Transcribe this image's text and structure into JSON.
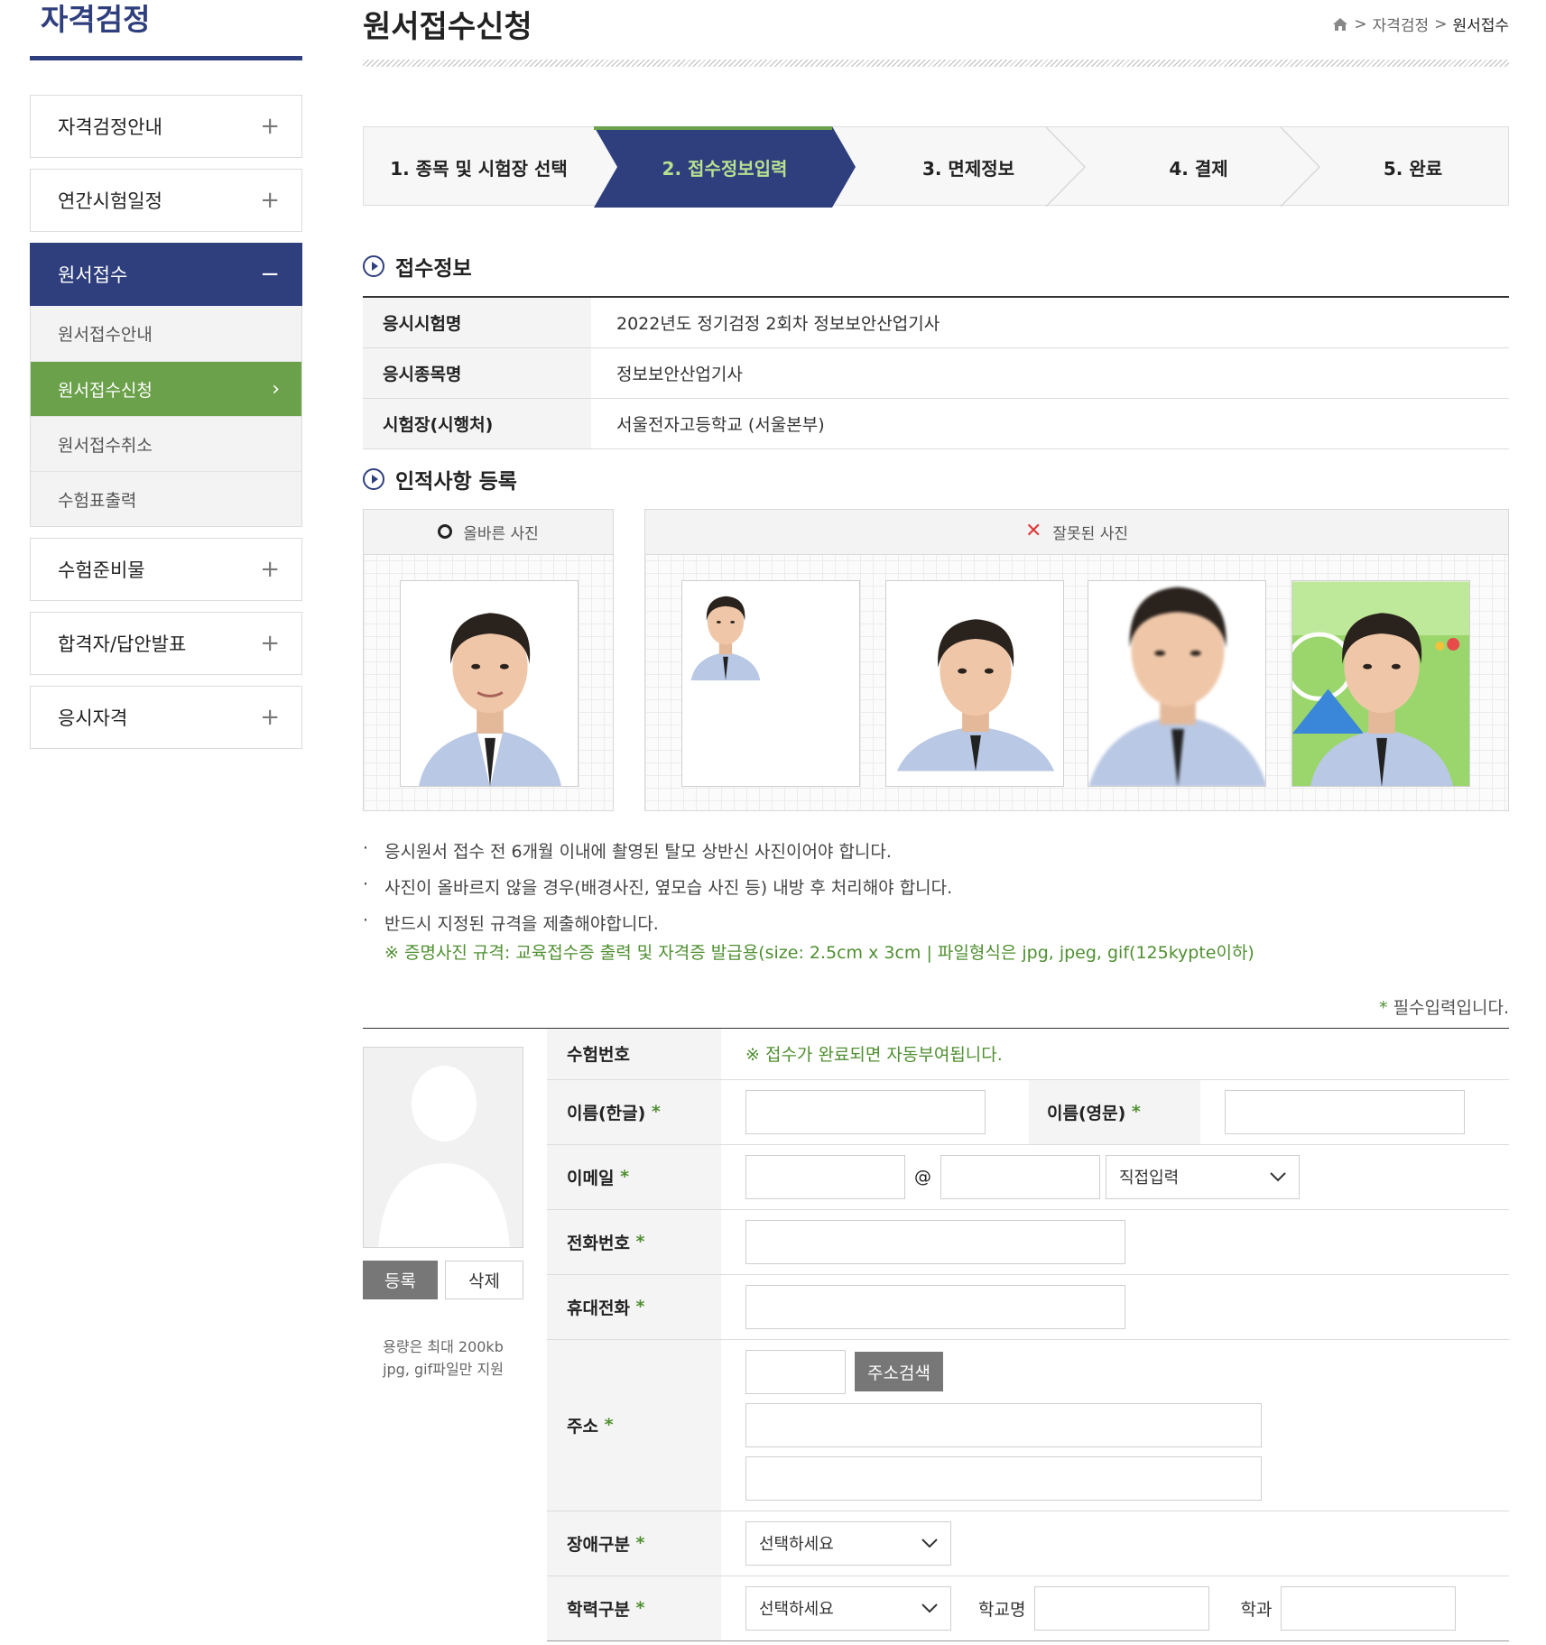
{
  "sidebar": {
    "title": "자격검정",
    "menu": [
      {
        "label": "자격검정안내",
        "sign": "+"
      },
      {
        "label": "연간시험일정",
        "sign": "+"
      },
      {
        "label": "원서접수",
        "sign": "−"
      },
      {
        "label": "수험준비물",
        "sign": "+"
      },
      {
        "label": "합격자/답안발표",
        "sign": "+"
      },
      {
        "label": "응시자격",
        "sign": "+"
      }
    ],
    "submenu": [
      {
        "label": "원서접수안내"
      },
      {
        "label": "원서접수신청",
        "chev": "›"
      },
      {
        "label": "원서접수취소"
      },
      {
        "label": "수험표출력"
      }
    ]
  },
  "header": {
    "title": "원서접수신청",
    "breadcrumb": [
      ">",
      "자격검정",
      ">",
      "원서접수"
    ]
  },
  "steps": [
    "1. 종목 및 시험장 선택",
    "2. 접수정보입력",
    "3. 면제정보",
    "4. 결제",
    "5. 완료"
  ],
  "reception": {
    "heading": "접수정보",
    "rows": [
      {
        "key": "응시시험명",
        "value": "2022년도 정기검정 2회차 정보보안산업기사"
      },
      {
        "key": "응시종목명",
        "value": "정보보안산업기사"
      },
      {
        "key": "시험장(시행처)",
        "value": "서울전자고등학교 (서울본부)"
      }
    ]
  },
  "personal": {
    "heading": "인적사항 등록",
    "correct_label": "올바른 사진",
    "wrong_label": "잘못된 사진"
  },
  "notes": {
    "items": [
      "응시원서 접수 전 6개월 이내에 촬영된 탈모 상반신 사진이어야 합니다.",
      "사진이 올바르지 않을 경우(배경사진, 옆모습 사진 등) 내방 후 처리해야 합니다.",
      "반드시 지정된 규격을 제출해야합니다."
    ],
    "spec": "※ 증명사진 규격: 교육접수증 출력 및 자격증 발급용(size: 2.5cm x 3cm | 파일형식은 jpg, jpeg, gif(125kypte이하)",
    "required": "필수입력입니다."
  },
  "profile": {
    "register": "등록",
    "delete": "삭제",
    "note1": "용량은 최대 200kb",
    "note2": "jpg, gif파일만 지원"
  },
  "form": {
    "exam_no_label": "수험번호",
    "exam_no_note": "※ 접수가 완료되면 자동부여됩니다.",
    "name_kr_label": "이름(한글)",
    "name_en_label": "이름(영문)",
    "email_label": "이메일",
    "at": "@",
    "email_domain_select": "직접입력",
    "phone_label": "전화번호",
    "mobile_label": "휴대전화",
    "address_label": "주소",
    "address_button": "주소검색",
    "disability_label": "장애구분",
    "disability_select": "선택하세요",
    "education_label": "학력구분",
    "education_select": "선택하세요",
    "school_label": "학교명",
    "major_label": "학과",
    "star": "*"
  },
  "colors": {
    "navy": "#2f3f7e",
    "green": "#6ba14b",
    "note_green": "#4f8f30"
  }
}
